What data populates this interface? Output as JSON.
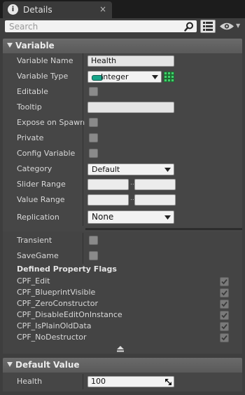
{
  "tab": {
    "title": "Details",
    "info_icon": "i",
    "close_label": "×"
  },
  "search": {
    "placeholder": "Search"
  },
  "variable_section": {
    "title": "Variable",
    "rows": {
      "name_label": "Variable Name",
      "name_value": "Health",
      "type_label": "Variable Type",
      "type_value": "Integer",
      "editable_label": "Editable",
      "tooltip_label": "Tooltip",
      "tooltip_value": "",
      "expose_label": "Expose on Spawn",
      "private_label": "Private",
      "config_label": "Config Variable",
      "category_label": "Category",
      "category_value": "Default",
      "slider_label": "Slider Range",
      "value_range_label": "Value Range",
      "range_separator": "..",
      "replication_label": "Replication",
      "replication_value": "None"
    },
    "transient_label": "Transient",
    "savegame_label": "SaveGame",
    "flags_title": "Defined Property Flags",
    "flags": [
      {
        "label": "CPF_Edit",
        "checked": true
      },
      {
        "label": "CPF_BlueprintVisible",
        "checked": true
      },
      {
        "label": "CPF_ZeroConstructor",
        "checked": true
      },
      {
        "label": "CPF_DisableEditOnInstance",
        "checked": true
      },
      {
        "label": "CPF_IsPlainOldData",
        "checked": true
      },
      {
        "label": "CPF_NoDestructor",
        "checked": true
      }
    ]
  },
  "default_section": {
    "title": "Default Value",
    "health_label": "Health",
    "health_value": "100"
  },
  "icons": {
    "search": "search-icon",
    "grid_view": "grid-view-icon",
    "visibility": "eye-icon",
    "pin_type": "integer-pin-icon",
    "container_type": "grid-container-icon",
    "collapse": "collapse-arrow-icon"
  },
  "colors": {
    "integer_pin": "#17a58a",
    "container_icon": "#3fd16a"
  }
}
